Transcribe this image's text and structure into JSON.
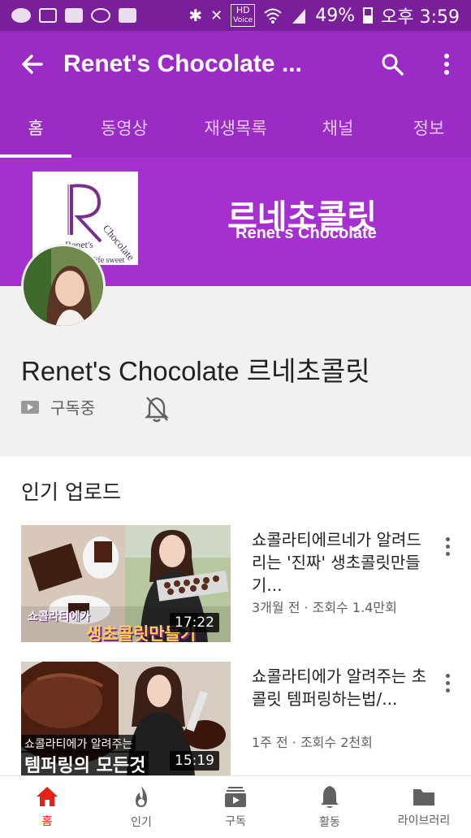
{
  "status_bar": {
    "hd_label": "HD",
    "voice_label": "Voice",
    "battery": "49%",
    "time": "오후 3:59"
  },
  "app_bar": {
    "title": "Renet's Chocolate ...",
    "back_icon": "arrow-back-icon",
    "search_icon": "search-icon",
    "more_icon": "more-vert-icon"
  },
  "tabs": [
    {
      "label": "홈",
      "active": true
    },
    {
      "label": "동영상",
      "active": false
    },
    {
      "label": "재생목록",
      "active": false
    },
    {
      "label": "채널",
      "active": false
    },
    {
      "label": "정보",
      "active": false
    }
  ],
  "banner": {
    "title": "르네초콜릿",
    "subtitle": "Renet’s Chocolate",
    "logo_letter": "R",
    "logo_brand": "Renet's",
    "logo_product": "Chocolate",
    "logo_tagline": "ur life sweet"
  },
  "channel": {
    "name": "Renet's Chocolate 르네초콜릿",
    "subscribe_label": "구독중"
  },
  "section": {
    "title": "인기 업로드"
  },
  "videos": [
    {
      "title": "쇼콜라티에르네가 알려드리는 '진짜' 생초콜릿만들기...",
      "meta": "3개월 전 · 조회수 1.4만회",
      "duration": "17:22",
      "caption_top": "쇼콜라티에가",
      "caption_bottom": "생초콜릿만들기"
    },
    {
      "title": "쇼콜라티에가 알려주는 초콜릿 템퍼링하는법/...",
      "meta": "1주 전 · 조회수 2천회",
      "duration": "15:19",
      "caption_top": "쇼콜라티에가 알려주는",
      "caption_bottom": "템퍼링의 모든것"
    }
  ],
  "bottom_nav": [
    {
      "label": "홈",
      "icon": "home-icon",
      "active": true
    },
    {
      "label": "인기",
      "icon": "trending-icon",
      "active": false
    },
    {
      "label": "구독",
      "icon": "subscriptions-icon",
      "active": false
    },
    {
      "label": "활동",
      "icon": "bell-icon",
      "active": false
    },
    {
      "label": "라이브러리",
      "icon": "folder-icon",
      "active": false
    }
  ],
  "colors": {
    "status_bar": "#7a1f9a",
    "app_bar": "#9a2bc4",
    "banner": "#a630cf",
    "active_nav": "#e62117"
  }
}
